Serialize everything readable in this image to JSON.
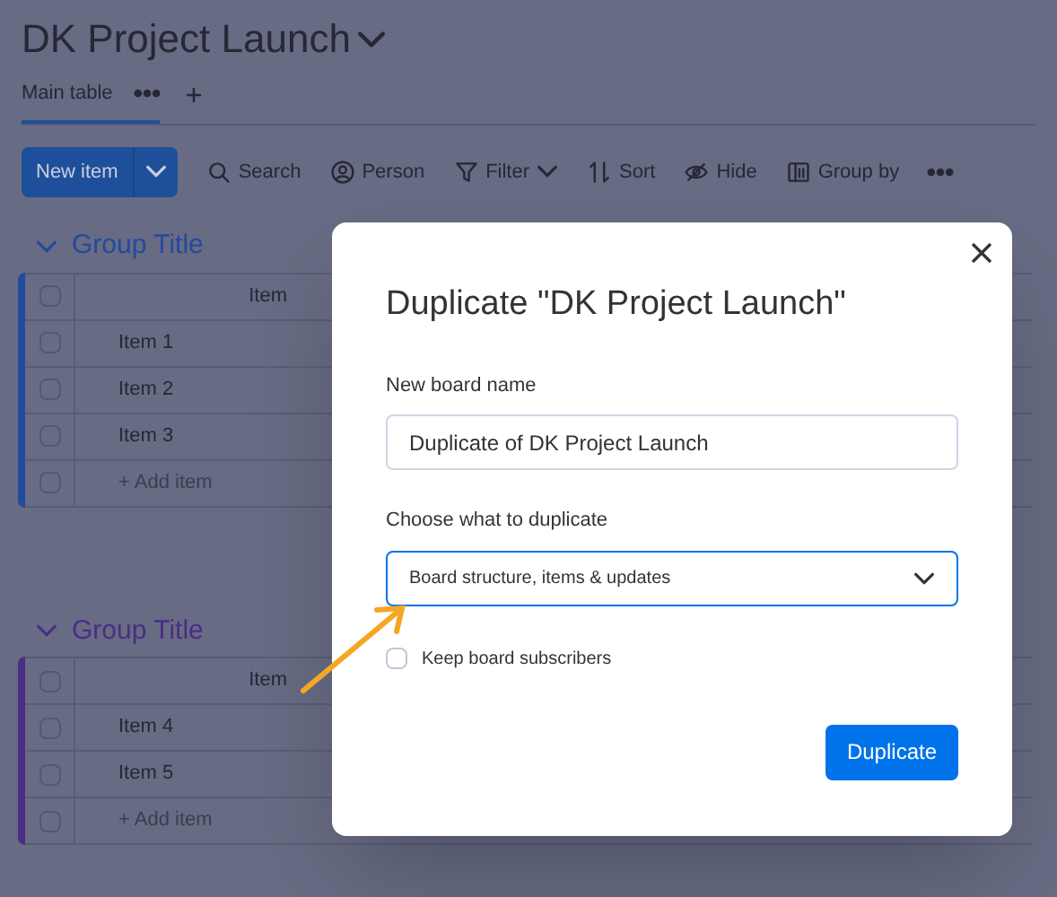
{
  "board": {
    "title": "DK Project Launch"
  },
  "tabs": [
    {
      "label": "Main table",
      "selected": true
    }
  ],
  "toolbar": {
    "new_item": "New item",
    "actions": [
      {
        "kind": "search",
        "label": "Search"
      },
      {
        "kind": "person",
        "label": "Person"
      },
      {
        "kind": "filter",
        "label": "Filter"
      },
      {
        "kind": "sort",
        "label": "Sort"
      },
      {
        "kind": "hide",
        "label": "Hide"
      },
      {
        "kind": "group",
        "label": "Group by"
      }
    ]
  },
  "groups": [
    {
      "title": "Group Title",
      "color": "#234a9e",
      "column_header": "Item",
      "header_checked": false,
      "items": [
        {
          "label": "Item 1",
          "checked": false
        },
        {
          "label": "Item 2",
          "checked": false
        },
        {
          "label": "Item 3",
          "checked": false
        }
      ],
      "add_item": "+ Add item",
      "add_checked": false
    },
    {
      "title": "Group Title",
      "color": "#4b2d85",
      "column_header": "Item",
      "header_checked": false,
      "items": [
        {
          "label": "Item 4",
          "checked": false
        },
        {
          "label": "Item 5",
          "checked": false
        }
      ],
      "add_item": "+ Add item",
      "add_checked": false
    }
  ],
  "dialog": {
    "title": "Duplicate \"DK Project Launch\"",
    "name_label": "New board name",
    "name_value": "Duplicate of DK Project Launch",
    "choose_label": "Choose what to duplicate",
    "choice": "Board structure, items & updates",
    "keep_subscribers": {
      "label": "Keep board subscribers",
      "checked": false
    },
    "button": "Duplicate"
  }
}
